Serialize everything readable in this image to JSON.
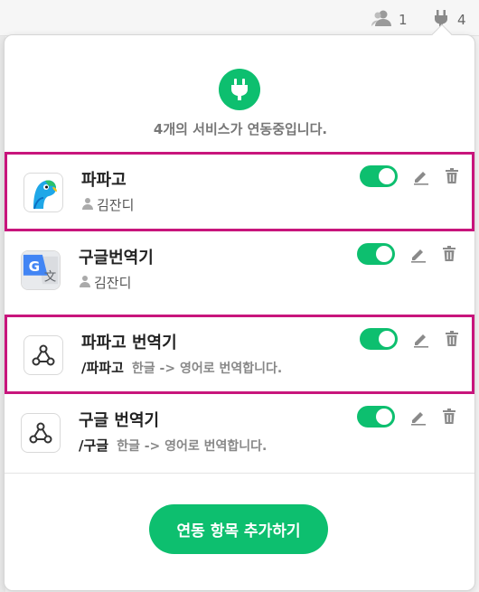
{
  "topbar": {
    "users_count": "1",
    "plugins_count": "4"
  },
  "panel": {
    "header_text": "4개의 서비스가 연동중입니다.",
    "add_button_label": "연동 항목 추가하기"
  },
  "services": [
    {
      "name": "파파고",
      "user": "김잔디",
      "command": "",
      "description": "",
      "icon": "papago-parrot-icon",
      "enabled": true
    },
    {
      "name": "구글번역기",
      "user": "김잔디",
      "command": "",
      "description": "",
      "icon": "google-translate-icon",
      "enabled": true
    },
    {
      "name": "파파고 번역기",
      "user": "",
      "command": "/파파고",
      "description": "한글 -> 영어로 번역합니다.",
      "icon": "webhook-icon",
      "enabled": true
    },
    {
      "name": "구글 번역기",
      "user": "",
      "command": "/구글",
      "description": "한글 -> 영어로 번역합니다.",
      "icon": "webhook-icon",
      "enabled": true
    }
  ],
  "colors": {
    "accent": "#0dbf6f",
    "highlight": "#c8157c"
  }
}
